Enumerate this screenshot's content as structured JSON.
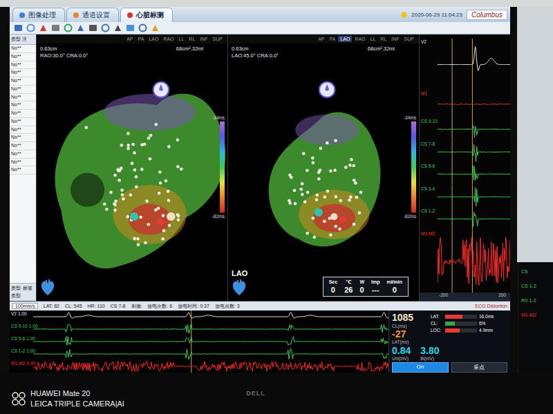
{
  "tabs": [
    {
      "label": "图像处理",
      "selected": false
    },
    {
      "label": "通道设置",
      "selected": false
    },
    {
      "label": "心脏标测",
      "selected": true
    }
  ],
  "header": {
    "datetime": "2020-06-29 11:04:23",
    "brand": "Columbus"
  },
  "left_table": {
    "columns": [
      "类型",
      "注"
    ],
    "rows": [
      "No**",
      "No**",
      "No**",
      "No**",
      "No**",
      "No**",
      "No**",
      "No**",
      "No**",
      "No**",
      "No**",
      "No**",
      "No**",
      "No**",
      "No**",
      "No**"
    ],
    "footer": [
      "类型",
      "标签",
      "类型"
    ]
  },
  "views": [
    {
      "scale": "0.63cm",
      "angle": "RAO:30.0° CRA:0.0°",
      "size": "68cm²,32ml",
      "scale_max": "-34ms",
      "scale_min": "-82ms",
      "buttons": [
        {
          "label": "AP",
          "selected": false
        },
        {
          "label": "PA",
          "selected": false
        },
        {
          "label": "LAO",
          "selected": false
        },
        {
          "label": "RAO",
          "selected": false
        },
        {
          "label": "LL",
          "selected": false
        },
        {
          "label": "RL",
          "selected": false
        },
        {
          "label": "INF",
          "selected": false
        },
        {
          "label": "SUP",
          "selected": false
        }
      ]
    },
    {
      "scale": "0.63cm",
      "angle": "LAO:45.0° CRA:0.0°",
      "size": "68cm²,32ml",
      "scale_max": "-34ms",
      "scale_min": "-82ms",
      "label": "LAO",
      "buttons": [
        {
          "label": "AP",
          "selected": false
        },
        {
          "label": "PA",
          "selected": false
        },
        {
          "label": "LAO",
          "selected": true
        },
        {
          "label": "RAO",
          "selected": false
        },
        {
          "label": "LL",
          "selected": false
        },
        {
          "label": "RL",
          "selected": false
        },
        {
          "label": "INF",
          "selected": false
        },
        {
          "label": "SUP",
          "selected": false
        }
      ]
    }
  ],
  "ablation": {
    "columns": [
      "Sec",
      "℃",
      "W",
      "Imp",
      "ml/min"
    ],
    "values": [
      "0",
      "26",
      "0",
      "---",
      "0"
    ]
  },
  "ecg_panel": {
    "channels": [
      {
        "label": "V2",
        "color": "#e8e8e8",
        "kind": "ecg"
      },
      {
        "label": "M1",
        "color": "#e53935",
        "kind": "flat"
      },
      {
        "label": "CS 9-10",
        "color": "#3fd05a",
        "kind": "spike"
      },
      {
        "label": "CS 7-8",
        "color": "#3fd05a",
        "kind": "spike"
      },
      {
        "label": "CS 5-6",
        "color": "#3fd05a",
        "kind": "spike"
      },
      {
        "label": "CS 3-4",
        "color": "#3fd05a",
        "kind": "spike"
      },
      {
        "label": "CS 1-2",
        "color": "#3fd05a",
        "kind": "spike"
      },
      {
        "label": "M1-M2",
        "color": "#ff2a2a",
        "kind": "noise"
      }
    ],
    "axis": [
      "-200",
      "200"
    ]
  },
  "strip": {
    "speed": "100mm/s",
    "items": [
      "LAT: 82",
      "CL: 545",
      "HR: 110",
      "CS 7-8",
      "刺激:",
      "放电次数: 6",
      "放电时间: 0:37",
      "放电点数: 3"
    ],
    "warning": "ECG Distortion",
    "channels": [
      {
        "label": "V2",
        "gain": "1.00",
        "color": "#e8e8e8",
        "kind": "ecg"
      },
      {
        "label": "CS 9-10",
        "gain": "1.00",
        "color": "#3fd05a",
        "kind": "spike"
      },
      {
        "label": "CS 5-6",
        "gain": "1.00",
        "color": "#3fd05a",
        "kind": "spike"
      },
      {
        "label": "CS 1-2",
        "gain": "1.00",
        "color": "#3fd05a",
        "kind": "spike"
      },
      {
        "label": "M1-M2",
        "gain": "0.40",
        "color": "#ff2a2a",
        "kind": "noise"
      }
    ]
  },
  "readouts": {
    "cl": {
      "value": "1085",
      "unit": "CL(ms)"
    },
    "lat": {
      "value": "-27",
      "unit": "LAT(ms)"
    },
    "bars": [
      {
        "label": "LAT:",
        "value": "16.0ms",
        "level": 0.55,
        "color": "#e53935"
      },
      {
        "label": "CL:",
        "value": "6%",
        "level": 0.3,
        "color": "#43a047"
      },
      {
        "label": "LOC:",
        "value": "4.9mm",
        "level": 0.45,
        "color": "#e53935"
      }
    ],
    "uni": {
      "value": "0.84",
      "unit": "Uni(mV)"
    },
    "bi": {
      "value": "3.80",
      "unit": "Bi(mV)"
    },
    "buttons": [
      {
        "label": "On",
        "selected": true
      },
      {
        "label": "采点",
        "selected": false
      }
    ]
  },
  "side_monitor": {
    "labels": [
      {
        "label": "CS",
        "color": "#3fd05a"
      },
      {
        "label": "CS 1-2",
        "color": "#3fd05a"
      },
      {
        "label": "RV 1-2",
        "color": "#3fd05a"
      },
      {
        "label": "M1-M2",
        "color": "#ff2a2a"
      }
    ]
  },
  "bezel": {
    "logo": "DELL"
  },
  "watermark": [
    "HUAWEI Mate 20",
    "LEICA TRIPLE CAMERA|AI"
  ]
}
